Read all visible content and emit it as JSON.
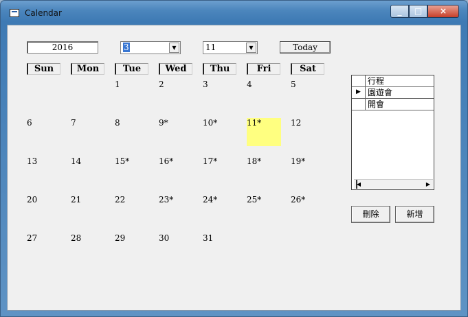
{
  "window": {
    "title": "Calendar",
    "min": "_",
    "max": "□",
    "close": "×"
  },
  "toolbar": {
    "year": "2016",
    "month": "3",
    "day": "11",
    "today": "Today"
  },
  "weekdays": [
    "Sun",
    "Mon",
    "Tue",
    "Wed",
    "Thu",
    "Fri",
    "Sat"
  ],
  "calendar": {
    "selected_day": "11*",
    "weeks": [
      [
        "",
        "",
        "1",
        "2",
        "3",
        "4",
        "5"
      ],
      [
        "6",
        "7",
        "8",
        "9*",
        "10*",
        "11*",
        "12"
      ],
      [
        "13",
        "14",
        "15*",
        "16*",
        "17*",
        "18*",
        "19*"
      ],
      [
        "20",
        "21",
        "22",
        "23*",
        "24*",
        "25*",
        "26*"
      ],
      [
        "27",
        "28",
        "29",
        "30",
        "31",
        "",
        ""
      ]
    ]
  },
  "schedule": {
    "header": "行程",
    "rows": [
      {
        "marker": "▶",
        "text": "園遊會"
      },
      {
        "marker": "",
        "text": "開會"
      }
    ]
  },
  "buttons": {
    "delete": "刪除",
    "add": "新增"
  },
  "colors": {
    "highlight": "#ffff80",
    "title_bar": "#4c86bd"
  },
  "icons": {
    "app": "calendar-app-icon",
    "dropdown": "chevron-down-icon"
  }
}
